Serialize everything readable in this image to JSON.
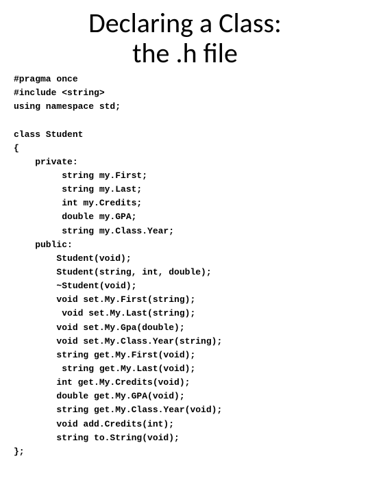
{
  "title_line1": "Declaring a Class:",
  "title_line2": "the .h file",
  "code_lines": [
    "#pragma once",
    "#include <string>",
    "using namespace std;",
    "",
    "class Student",
    "{",
    "    private:",
    "         string my.First;",
    "         string my.Last;",
    "         int my.Credits;",
    "         double my.GPA;",
    "         string my.Class.Year;",
    "    public:",
    "        Student(void);",
    "        Student(string, int, double);",
    "        ~Student(void);",
    "        void set.My.First(string);",
    "         void set.My.Last(string);",
    "        void set.My.Gpa(double);",
    "        void set.My.Class.Year(string);",
    "        string get.My.First(void);",
    "         string get.My.Last(void);",
    "        int get.My.Credits(void);",
    "        double get.My.GPA(void);",
    "        string get.My.Class.Year(void);",
    "        void add.Credits(int);",
    "        string to.String(void);",
    "};"
  ]
}
